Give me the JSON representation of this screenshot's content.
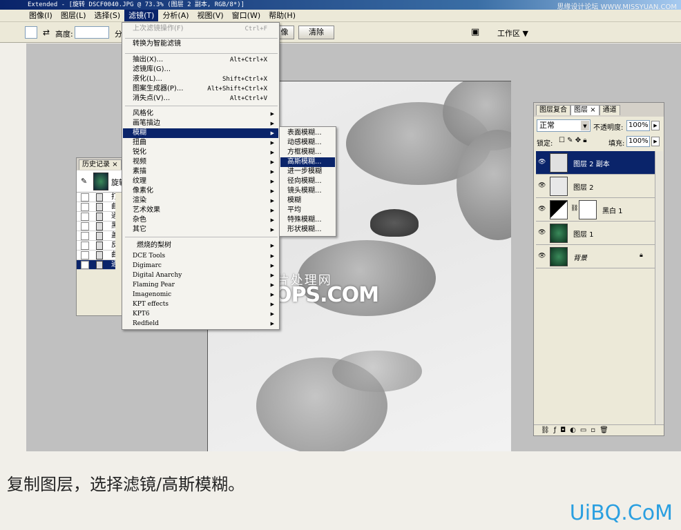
{
  "titlebar": {
    "text": "Extended - [旋转 DSCF0040.JPG @ 73.3% (图层 2 副本, RGB/8*)]",
    "watermark": "思缘设计论坛 WWW.MISSYUAN.COM"
  },
  "menubar": [
    "图像(I)",
    "图层(L)",
    "选择(S)",
    "滤镜(T)",
    "分析(A)",
    "视图(V)",
    "窗口(W)",
    "帮助(H)"
  ],
  "options": {
    "height_label": "高度:",
    "partial": "分",
    "btn_image": "像",
    "btn_clear": "清除",
    "workspace": "工作区"
  },
  "filter_menu": {
    "last": {
      "label": "上次滤镜操作(F)",
      "shortcut": "Ctrl+F"
    },
    "smart": "转换为智能滤镜",
    "group1": [
      {
        "label": "抽出(X)...",
        "shortcut": "Alt+Ctrl+X"
      },
      {
        "label": "滤镜库(G)...",
        "shortcut": ""
      },
      {
        "label": "液化(L)...",
        "shortcut": "Shift+Ctrl+X"
      },
      {
        "label": "图案生成器(P)...",
        "shortcut": "Alt+Shift+Ctrl+X"
      },
      {
        "label": "消失点(V)...",
        "shortcut": "Alt+Ctrl+V"
      }
    ],
    "group2": [
      "风格化",
      "画笔描边",
      "模糊",
      "扭曲",
      "锐化",
      "视频",
      "素描",
      "纹理",
      "像素化",
      "渲染",
      "艺术效果",
      "杂色",
      "其它"
    ],
    "group3": [
      "燃烧的梨树",
      "DCE Tools",
      "Digimarc",
      "Digital Anarchy",
      "Flaming Pear",
      "Imagenomic",
      "KPT effects",
      "KPT6",
      "Redfield"
    ]
  },
  "blur_submenu": [
    "表面模糊...",
    "动感模糊...",
    "方框模糊...",
    "高斯模糊...",
    "进一步模糊",
    "径向模糊...",
    "镜头模糊...",
    "模糊",
    "平均",
    "特殊模糊...",
    "形状模糊..."
  ],
  "history": {
    "tab": "历史记录",
    "snapshot": "旋转",
    "rows": [
      "打开",
      "曲线",
      "通道",
      "黑白",
      "盖印",
      "反相",
      "曲线",
      "通道"
    ]
  },
  "layers": {
    "tabs": [
      "图层复合",
      "图层",
      "通道"
    ],
    "blend": "正常",
    "opacity_label": "不透明度:",
    "opacity": "100%",
    "lock_label": "锁定:",
    "fill_label": "填充:",
    "fill": "100%",
    "rows": [
      "图层 2 副本",
      "图层 2",
      "黑白 1",
      "图层 1",
      "背景"
    ]
  },
  "watermark": {
    "line1": "WWW.  照片处理网",
    "line2": "PHOTOPS.COM"
  },
  "caption": "复制图层，选择滤镜/高斯模糊。",
  "brand": "UiBQ.CoM"
}
